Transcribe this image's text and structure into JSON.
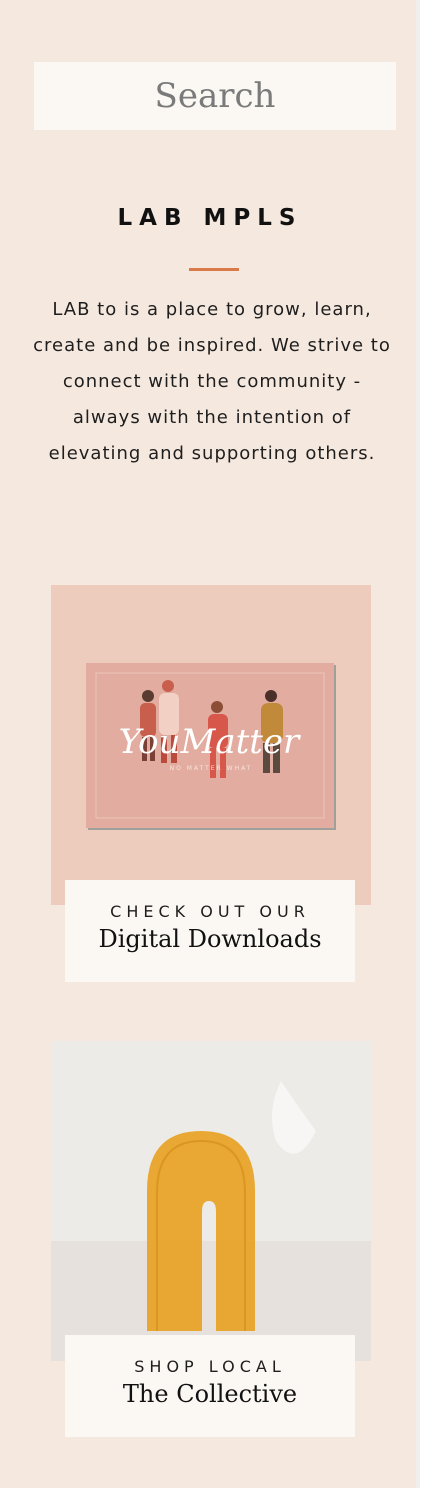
{
  "search": {
    "placeholder": "Search"
  },
  "brand": {
    "name": "LAB MPLS"
  },
  "about": {
    "text": "LAB to is a place to grow, learn, create and be inspired. We strive to connect with the community - always with the intention of elevating and supporting others."
  },
  "promos": [
    {
      "kicker": "CHECK OUT OUR",
      "title": "Digital Downloads",
      "image_text": "YouMatter",
      "image_subtext": "NO MATTER WHAT"
    },
    {
      "kicker": "SHOP LOCAL",
      "title": "The Collective"
    }
  ],
  "colors": {
    "background": "#f5e8df",
    "card": "#fbf7f3",
    "accent": "#d97a4a",
    "promo_bg": "#edcbbd"
  }
}
